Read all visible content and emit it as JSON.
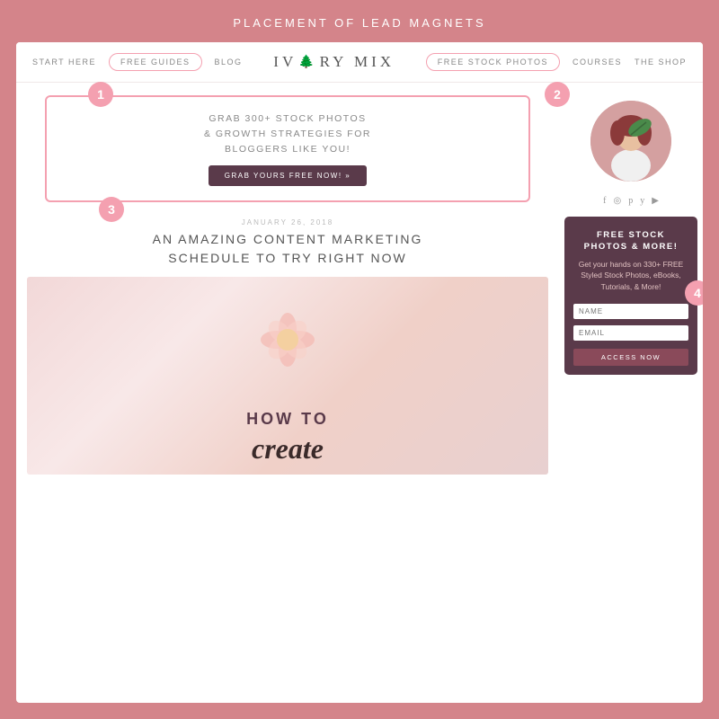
{
  "page": {
    "outer_title": "PLACEMENT OF LEAD MAGNETS",
    "background_color": "#d4848a"
  },
  "nav": {
    "left_items": [
      {
        "label": "START HERE",
        "type": "text"
      },
      {
        "label": "FREE GUIDES",
        "type": "pill"
      },
      {
        "label": "BLOG",
        "type": "text"
      }
    ],
    "logo": "IV",
    "logo_tree": "🌲",
    "logo_rest": "RY MIX",
    "right_items": [
      {
        "label": "FREE STOCK PHOTOS",
        "type": "pill"
      },
      {
        "label": "COURSES",
        "type": "text"
      },
      {
        "label": "THE SHOP",
        "type": "text"
      }
    ]
  },
  "badges": {
    "one": "1",
    "two": "2",
    "three": "3",
    "four": "4"
  },
  "hero_banner": {
    "title_line1": "GRAB 300+ STOCK PHOTOS",
    "title_line2": "& GROWTH STRATEGIES FOR",
    "title_line3": "BLOGGERS LIKE YOU!",
    "button_label": "GRAB YOURS FREE NOW! »"
  },
  "article": {
    "date": "JANUARY 26, 2018",
    "title_line1": "AN AMAZING CONTENT MARKETING",
    "title_line2": "SCHEDULE TO TRY RIGHT NOW",
    "image_how_to": "HOW TO",
    "image_create": "create"
  },
  "sidebar": {
    "social_icons": [
      "f",
      "◎",
      "p",
      "y",
      "▶"
    ],
    "widget": {
      "title_line1": "FREE STOCK",
      "title_line2": "PHOTOS & MORE!",
      "description": "Get your hands on 330+ FREE Styled Stock Photos, eBooks, Tutorials, & More!",
      "name_placeholder": "NAME",
      "email_placeholder": "EMAIL",
      "button_label": "ACCESS NOW"
    }
  }
}
